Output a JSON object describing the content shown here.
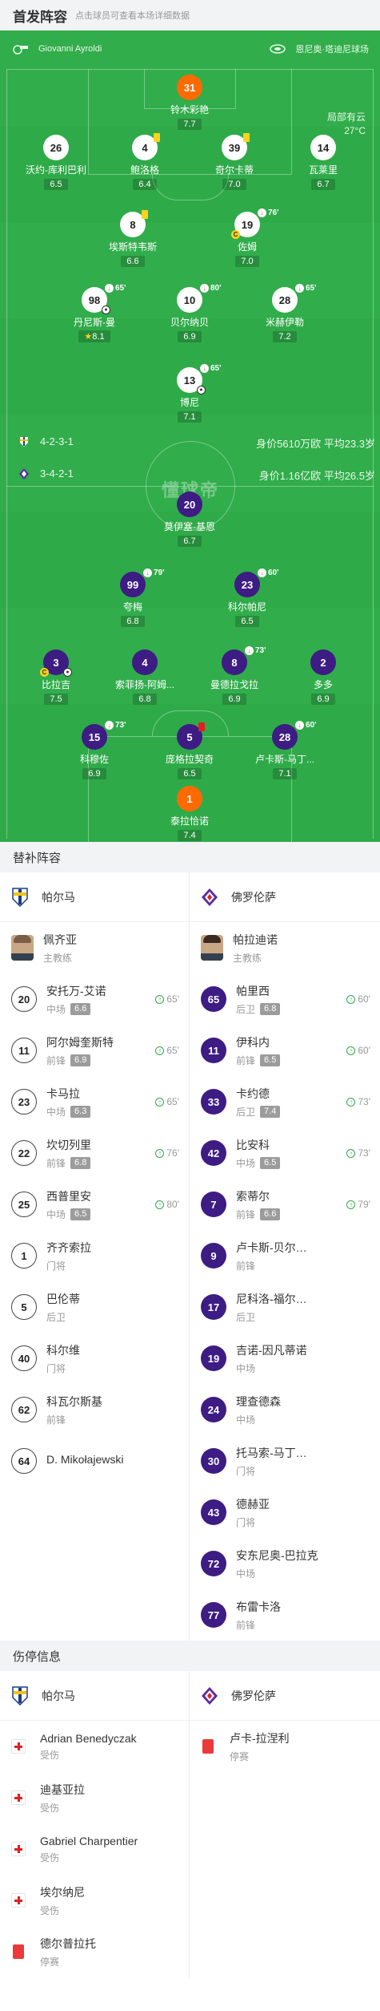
{
  "header": {
    "title": "首发阵容",
    "subtitle": "点击球员可查看本场详细数据"
  },
  "pitch": {
    "referee": "Giovanni Ayroldi",
    "stadium": "恩尼奥·塔迪尼球场",
    "weather": "局部有云",
    "temperature": "27°C",
    "home_formation": "4-2-3-1",
    "home_value": "身价5610万欧 平均23.3岁",
    "away_formation": "3-4-2-1",
    "away_value": "身价1.16亿欧 平均26.5岁",
    "center_logo": "懂球帝",
    "colors": {
      "pitch": "#2faa49",
      "home_disc": "#ffffff",
      "away_disc": "#3d1c83",
      "goalkeeper_disc": "#ff6a00"
    }
  },
  "home_lineup": [
    {
      "number": "31",
      "name": "铃木彩艳",
      "rating": "7.7"
    },
    {
      "number": "26",
      "name": "沃约-库利巴利",
      "rating": "6.5"
    },
    {
      "number": "4",
      "name": "鲍洛格",
      "rating": "6.4"
    },
    {
      "number": "39",
      "name": "奇尔卡蒂",
      "rating": "7.0"
    },
    {
      "number": "14",
      "name": "瓦莱里",
      "rating": "6.7"
    },
    {
      "number": "8",
      "name": "埃斯特韦斯",
      "rating": "6.6"
    },
    {
      "number": "19",
      "name": "佐姆",
      "rating": "7.0",
      "sub_minute": "76'"
    },
    {
      "number": "98",
      "name": "丹尼斯-曼",
      "rating": "8.1",
      "sub_minute": "65'"
    },
    {
      "number": "10",
      "name": "贝尔纳贝",
      "rating": "6.9",
      "sub_minute": "80'"
    },
    {
      "number": "28",
      "name": "米赫伊勒",
      "rating": "7.2",
      "sub_minute": "65'"
    },
    {
      "number": "13",
      "name": "博尼",
      "rating": "7.1",
      "sub_minute": "65'"
    }
  ],
  "away_lineup": [
    {
      "number": "20",
      "name": "莫伊塞-基恩",
      "rating": "6.7"
    },
    {
      "number": "99",
      "name": "夸梅",
      "rating": "6.8",
      "sub_minute": "79'"
    },
    {
      "number": "23",
      "name": "科尔帕尼",
      "rating": "6.5",
      "sub_minute": "60'"
    },
    {
      "number": "3",
      "name": "比拉吉",
      "rating": "7.5"
    },
    {
      "number": "4",
      "name": "索菲扬-阿姆...",
      "rating": "6.8"
    },
    {
      "number": "8",
      "name": "曼德拉戈拉",
      "rating": "6.9",
      "sub_minute": "73'"
    },
    {
      "number": "2",
      "name": "多多",
      "rating": "6.9"
    },
    {
      "number": "15",
      "name": "科穆佐",
      "rating": "6.9",
      "sub_minute": "73'"
    },
    {
      "number": "5",
      "name": "庞格拉契奇",
      "rating": "6.5"
    },
    {
      "number": "28",
      "name": "卢卡斯-马丁...",
      "rating": "7.1",
      "sub_minute": "60'"
    },
    {
      "number": "1",
      "name": "泰拉恰诺",
      "rating": "7.4"
    }
  ],
  "subs": {
    "title": "替补阵容",
    "home_team": "帕尔马",
    "away_team": "佛罗伦萨",
    "home_coach": {
      "name": "佩齐亚",
      "role": "主教练"
    },
    "away_coach": {
      "name": "帕拉迪诺",
      "role": "主教练"
    },
    "home": [
      {
        "number": "20",
        "name": "安托万-艾诺",
        "position": "中场",
        "rating": "6.6",
        "minute": "65'"
      },
      {
        "number": "11",
        "name": "阿尔姆奎斯特",
        "position": "前锋",
        "rating": "6.9",
        "minute": "65'"
      },
      {
        "number": "23",
        "name": "卡马拉",
        "position": "中场",
        "rating": "6.3",
        "minute": "65'"
      },
      {
        "number": "22",
        "name": "坎切列里",
        "position": "前锋",
        "rating": "6.8",
        "minute": "76'"
      },
      {
        "number": "25",
        "name": "西普里安",
        "position": "中场",
        "rating": "6.5",
        "minute": "80'"
      },
      {
        "number": "1",
        "name": "齐齐索拉",
        "position": "门将"
      },
      {
        "number": "5",
        "name": "巴伦蒂",
        "position": "后卫"
      },
      {
        "number": "40",
        "name": "科尔维",
        "position": "门将"
      },
      {
        "number": "62",
        "name": "科瓦尔斯基",
        "position": "前锋"
      },
      {
        "number": "64",
        "name": "D. Mikołajewski",
        "position": ""
      }
    ],
    "away": [
      {
        "number": "65",
        "name": "帕里西",
        "position": "后卫",
        "rating": "6.8",
        "minute": "60'"
      },
      {
        "number": "11",
        "name": "伊科内",
        "position": "前锋",
        "rating": "6.5",
        "minute": "60'"
      },
      {
        "number": "33",
        "name": "卡约德",
        "position": "后卫",
        "rating": "7.4",
        "minute": "73'"
      },
      {
        "number": "42",
        "name": "比安科",
        "position": "中场",
        "rating": "6.5",
        "minute": "73'"
      },
      {
        "number": "7",
        "name": "索蒂尔",
        "position": "前锋",
        "rating": "6.6",
        "minute": "79'"
      },
      {
        "number": "9",
        "name": "卢卡斯-贝尔…",
        "position": "前锋"
      },
      {
        "number": "17",
        "name": "尼科洛-福尔…",
        "position": "后卫"
      },
      {
        "number": "19",
        "name": "吉诺-因凡蒂诺",
        "position": "中场"
      },
      {
        "number": "24",
        "name": "理查德森",
        "position": "中场"
      },
      {
        "number": "30",
        "name": "托马索-马丁…",
        "position": "门将"
      },
      {
        "number": "43",
        "name": "德赫亚",
        "position": "门将"
      },
      {
        "number": "72",
        "name": "安东尼奥-巴拉克",
        "position": "中场"
      },
      {
        "number": "77",
        "name": "布雷卡洛",
        "position": "前锋"
      }
    ]
  },
  "injuries": {
    "title": "伤停信息",
    "home_team": "帕尔马",
    "away_team": "佛罗伦萨",
    "home": [
      {
        "name": "Adrian Benedyczak",
        "status": "受伤",
        "type": "injury"
      },
      {
        "name": "迪基亚拉",
        "status": "受伤",
        "type": "injury"
      },
      {
        "name": "Gabriel Charpentier",
        "status": "受伤",
        "type": "injury"
      },
      {
        "name": "埃尔纳尼",
        "status": "受伤",
        "type": "injury"
      },
      {
        "name": "德尔普拉托",
        "status": "停赛",
        "type": "suspension"
      }
    ],
    "away": [
      {
        "name": "卢卡-拉涅利",
        "status": "停赛",
        "type": "suspension"
      }
    ]
  }
}
